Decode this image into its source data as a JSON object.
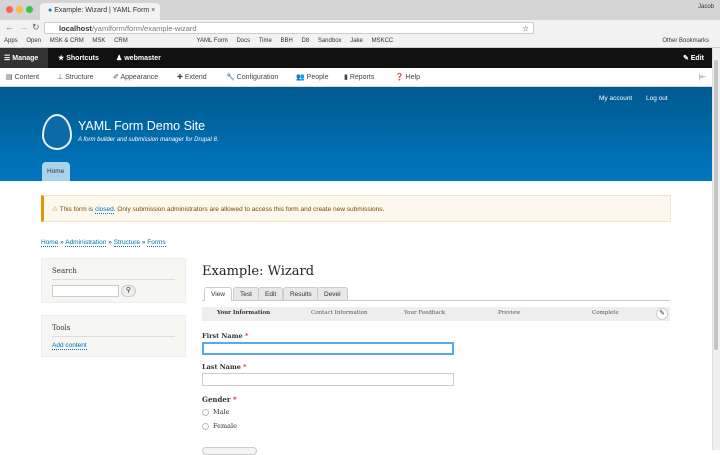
{
  "browser": {
    "tab_title": "Example: Wizard | YAML Form",
    "user": "Jacob",
    "url_host": "localhost",
    "url_path": "/yamlform/form/example-wizard",
    "bookmarks": [
      "Apps",
      "Open",
      "MSK & CRM",
      "MSK",
      "CRM",
      "YAML Form",
      "Docs",
      "Time",
      "BBH",
      "D8",
      "Sandbox",
      "Jake",
      "MSKCC",
      "Other Bookmarks"
    ]
  },
  "toolbar": {
    "manage": "Manage",
    "shortcuts": "Shortcuts",
    "user": "webmaster",
    "edit": "Edit"
  },
  "tray": [
    "Content",
    "Structure",
    "Appearance",
    "Extend",
    "Configuration",
    "People",
    "Reports",
    "Help"
  ],
  "header": {
    "my_account": "My account",
    "log_out": "Log out",
    "site_name": "YAML Form Demo Site",
    "slogan": "A form builder and submission manager for Drupal 8.",
    "home_tab": "Home"
  },
  "warning": {
    "pre": "This form is ",
    "link": "closed",
    "post": ". Only submission administrators are allowed to access this form and create new submissions."
  },
  "breadcrumb": [
    "Home",
    "Administration",
    "Structure",
    "Forms"
  ],
  "sidebar": {
    "search_title": "Search",
    "tools_title": "Tools",
    "add_content": "Add content"
  },
  "main": {
    "title": "Example: Wizard",
    "tabs": [
      "View",
      "Test",
      "Edit",
      "Results",
      "Devel"
    ],
    "steps": [
      "Your Information",
      "Contact Information",
      "Your Feedback",
      "Preview",
      "Complete"
    ],
    "first_name": "First Name",
    "last_name": "Last Name",
    "gender": "Gender",
    "required_mark": "*",
    "options": [
      "Male",
      "Female"
    ]
  },
  "colors": {
    "header_top": "#005a8f",
    "header_bottom": "#0077c0",
    "warning_accent": "#e09600",
    "focus": "#5aa9f0"
  }
}
